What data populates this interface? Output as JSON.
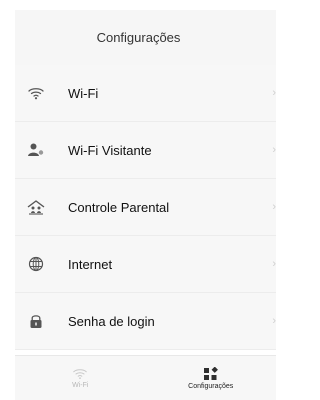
{
  "colors": {
    "background": "#ffffff",
    "surface": "#f7f7f7",
    "title": "#333333",
    "text": "#111111",
    "muted": "#b7b7b7",
    "icon": "#555555"
  },
  "header": {
    "title": "Configurações"
  },
  "menu": {
    "items": [
      {
        "label": "Wi-Fi",
        "icon": "wifi-icon"
      },
      {
        "label": "Wi-Fi Visitante",
        "icon": "guest-wifi-icon"
      },
      {
        "label": "Controle Parental",
        "icon": "parental-control-icon"
      },
      {
        "label": "Internet",
        "icon": "globe-icon"
      },
      {
        "label": "Senha de login",
        "icon": "lock-icon"
      }
    ]
  },
  "bottom_nav": {
    "tabs": [
      {
        "label": "Wi-Fi",
        "icon": "wifi-icon",
        "active": false
      },
      {
        "label": "Configurações",
        "icon": "grid-icon",
        "active": true
      }
    ]
  }
}
